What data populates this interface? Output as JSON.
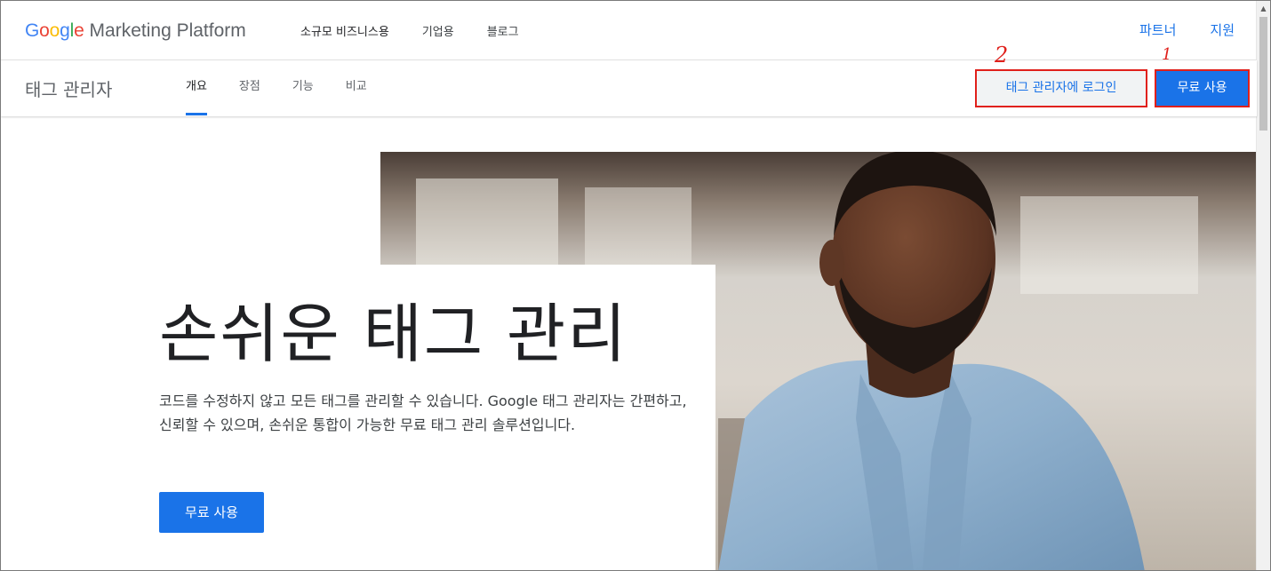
{
  "brand": {
    "google": "Google",
    "product_suite": "Marketing Platform",
    "colors": [
      "#4285F4",
      "#EA4335",
      "#FBBC05",
      "#4285F4",
      "#34A853",
      "#EA4335"
    ]
  },
  "top_nav": {
    "items": [
      "소규모 비즈니스용",
      "기업용",
      "블로그"
    ],
    "right_links": [
      "파트너",
      "지원"
    ]
  },
  "sub_nav": {
    "product": "태그 관리자",
    "tabs": [
      {
        "label": "개요",
        "active": true
      },
      {
        "label": "장점",
        "active": false
      },
      {
        "label": "기능",
        "active": false
      },
      {
        "label": "비교",
        "active": false
      }
    ],
    "login_button": "태그 관리자에 로그인",
    "free_button": "무료 사용"
  },
  "annotations": {
    "login_marker": "2",
    "free_marker": "1",
    "color": "#e0201b"
  },
  "hero": {
    "title": "손쉬운 태그 관리",
    "description": "코드를 수정하지 않고 모든 태그를 관리할 수 있습니다. Google 태그 관리자는 간편하고, 신뢰할 수 있으며, 손쉬운 통합이 가능한 무료 태그 관리 솔루션입니다.",
    "cta": "무료 사용",
    "image": "man-in-denim-shirt-photo"
  },
  "colors": {
    "accent": "#1a73e8",
    "annotation_red": "#e0201b"
  }
}
